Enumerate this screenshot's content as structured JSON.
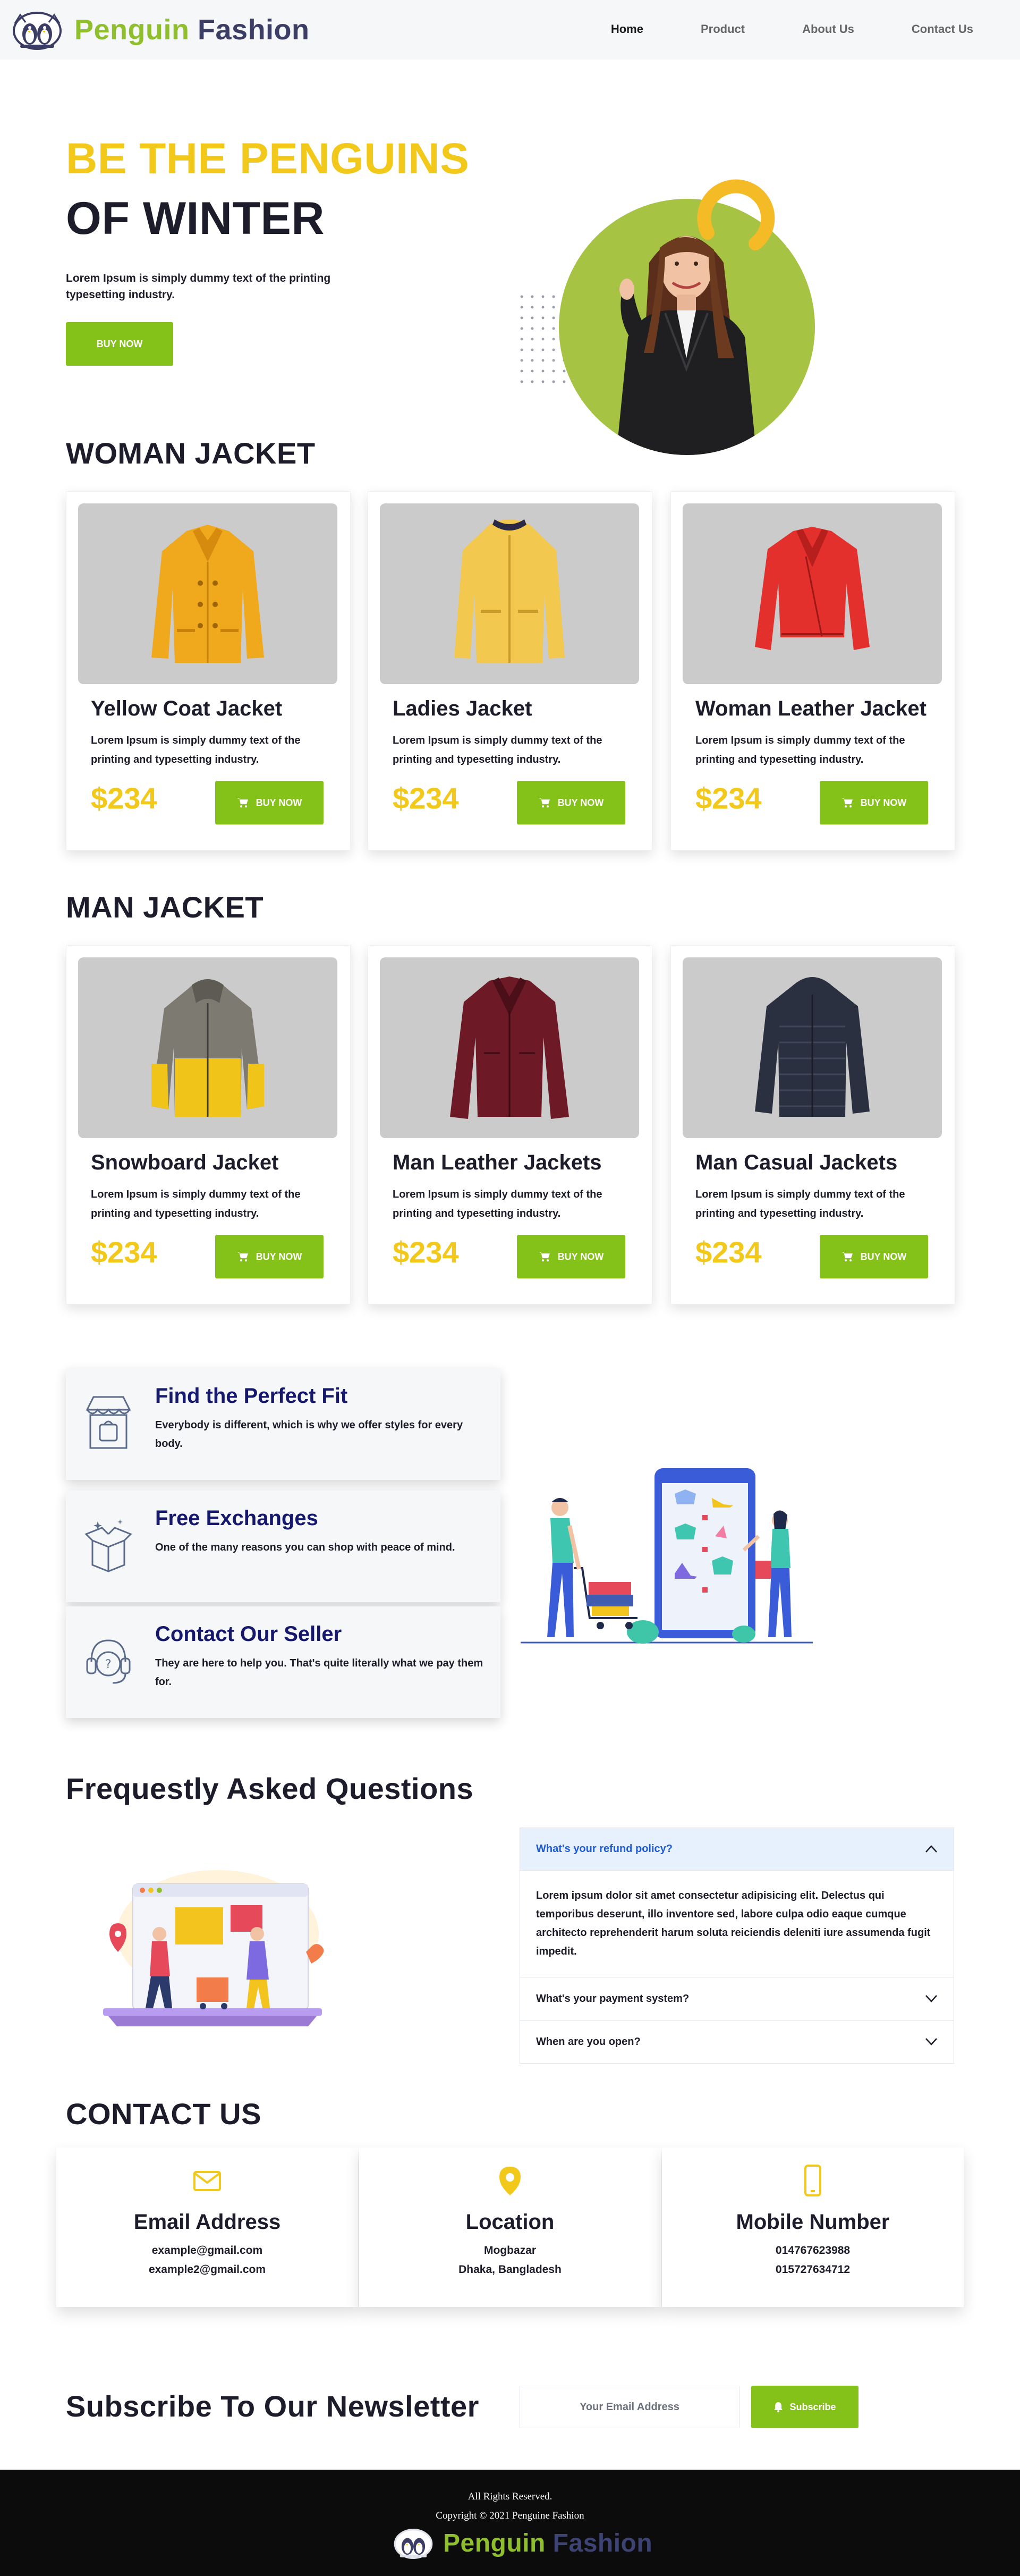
{
  "brand": {
    "part1": "Penguin",
    "part2": "Fashion"
  },
  "nav": [
    "Home",
    "Product",
    "About Us",
    "Contact Us"
  ],
  "hero": {
    "title_line1": "BE THE PENGUINS",
    "title_line2": "OF WINTER",
    "description": "Lorem Ipsum is simply dummy text of the printing typesetting industry.",
    "button": "BUY NOW"
  },
  "woman": {
    "title": "WOMAN JACKET",
    "products": [
      {
        "name": "Yellow Coat Jacket",
        "desc": "Lorem Ipsum is simply dummy text of the printing and typesetting industry.",
        "price": "$234",
        "button": "BUY NOW"
      },
      {
        "name": "Ladies Jacket",
        "desc": "Lorem Ipsum is simply dummy text of the printing and typesetting industry.",
        "price": "$234",
        "button": "BUY NOW"
      },
      {
        "name": "Woman Leather Jacket",
        "desc": "Lorem Ipsum is simply dummy text of the printing and typesetting industry.",
        "price": "$234",
        "button": "BUY NOW"
      }
    ]
  },
  "man": {
    "title": "MAN JACKET",
    "products": [
      {
        "name": "Snowboard Jacket",
        "desc": "Lorem Ipsum is simply dummy text of the printing and typesetting industry.",
        "price": "$234",
        "button": "BUY NOW"
      },
      {
        "name": "Man Leather Jackets",
        "desc": "Lorem Ipsum is simply dummy text of the printing and typesetting industry.",
        "price": "$234",
        "button": "BUY NOW"
      },
      {
        "name": "Man Casual Jackets",
        "desc": "Lorem Ipsum is simply dummy text of the printing and typesetting industry.",
        "price": "$234",
        "button": "BUY NOW"
      }
    ]
  },
  "features": [
    {
      "title": "Find the Perfect Fit",
      "desc": "Everybody is different, which is why we offer styles for every body.",
      "icon": "shop-stall-icon"
    },
    {
      "title": "Free Exchanges",
      "desc": "One of the many reasons you can shop with peace of mind.",
      "icon": "open-box-icon"
    },
    {
      "title": "Contact Our Seller",
      "desc": "They are here to help you. That's quite literally what we pay them for.",
      "icon": "headset-support-icon"
    }
  ],
  "faq": {
    "title": "Frequestly Asked Questions",
    "items": [
      {
        "q": "What's your refund policy?",
        "a": "Lorem ipsum dolor sit amet consectetur adipisicing elit. Delectus qui temporibus deserunt, illo inventore sed, labore culpa odio eaque cumque architecto reprehenderit harum soluta reiciendis deleniti iure assumenda fugit impedit.",
        "open": true
      },
      {
        "q": "What's your payment system?",
        "a": "",
        "open": false
      },
      {
        "q": "When are you open?",
        "a": "",
        "open": false
      }
    ]
  },
  "contact": {
    "title": "CONTACT US",
    "cards": [
      {
        "title": "Email Address",
        "line1": "example@gmail.com",
        "line2": "example2@gmail.com",
        "icon": "envelope-icon"
      },
      {
        "title": "Location",
        "line1": "Mogbazar",
        "line2": "Dhaka, Bangladesh",
        "icon": "map-pin-icon"
      },
      {
        "title": "Mobile Number",
        "line1": "014767623988",
        "line2": "015727634712",
        "icon": "mobile-phone-icon"
      }
    ]
  },
  "newsletter": {
    "title": "Subscribe To Our Newsletter",
    "placeholder": "Your Email Address",
    "button": "Subscribe"
  },
  "footer": {
    "rights": "All Rights Reserved.",
    "copyright": "Copyright © 2021 Penguine Fashion",
    "brand_part1": "Penguin",
    "brand_part2": "Fashion"
  },
  "colors": {
    "accent_green": "#84c21a",
    "accent_yellow": "#f2c81a",
    "brand_green": "#8fbf2c",
    "brand_navy": "#3c3d64",
    "feature_title": "#15186b",
    "faq_active": "#1d5ad8"
  }
}
